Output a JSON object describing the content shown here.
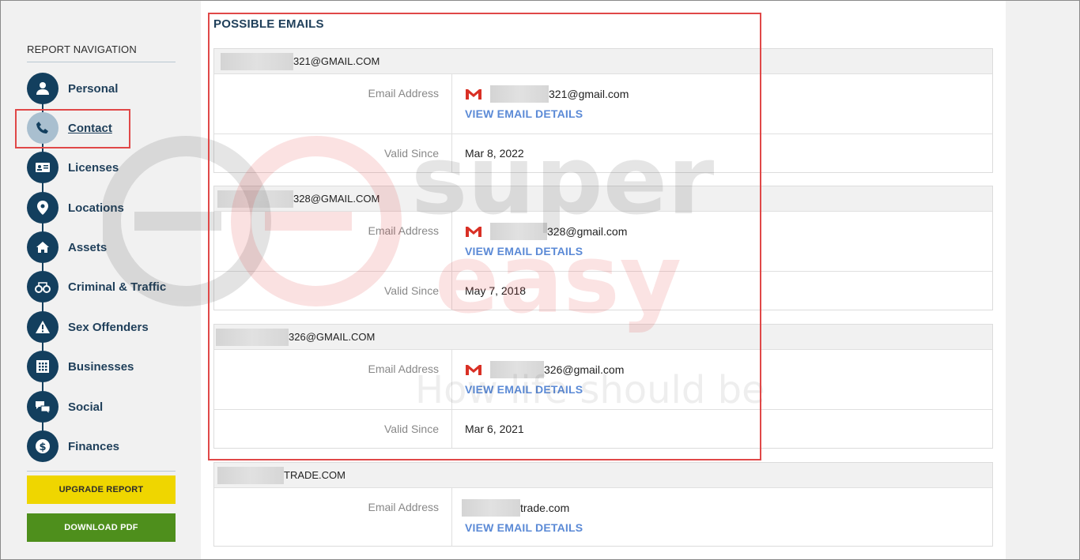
{
  "sidebar": {
    "title": "REPORT NAVIGATION",
    "items": [
      {
        "label": "Personal",
        "icon": "person-icon"
      },
      {
        "label": "Contact",
        "icon": "phone-icon"
      },
      {
        "label": "Licenses",
        "icon": "id-card-icon"
      },
      {
        "label": "Locations",
        "icon": "map-pin-icon"
      },
      {
        "label": "Assets",
        "icon": "home-icon"
      },
      {
        "label": "Criminal & Traffic",
        "icon": "handcuffs-icon"
      },
      {
        "label": "Sex Offenders",
        "icon": "warning-icon"
      },
      {
        "label": "Businesses",
        "icon": "building-icon"
      },
      {
        "label": "Social",
        "icon": "chat-icon"
      },
      {
        "label": "Finances",
        "icon": "dollar-icon"
      }
    ],
    "upgrade_label": "UPGRADE REPORT",
    "download_label": "DOWNLOAD PDF"
  },
  "main": {
    "section_title": "POSSIBLE EMAILS",
    "cards": [
      {
        "header": "321@GMAIL.COM",
        "email_label": "Email Address",
        "email_value": "321@gmail.com",
        "link": "VIEW EMAIL DETAILS",
        "since_label": "Valid Since",
        "since_value": "Mar 8, 2022"
      },
      {
        "header": "328@GMAIL.COM",
        "email_label": "Email Address",
        "email_value": "328@gmail.com",
        "link": "VIEW EMAIL DETAILS",
        "since_label": "Valid Since",
        "since_value": "May 7, 2018"
      },
      {
        "header": "326@GMAIL.COM",
        "email_label": "Email Address",
        "email_value": "326@gmail.com",
        "link": "VIEW EMAIL DETAILS",
        "since_label": "Valid Since",
        "since_value": "Mar 6, 2021"
      },
      {
        "header": "TRADE.COM",
        "email_label": "Email Address",
        "email_value": "trade.com",
        "link": "VIEW EMAIL DETAILS"
      }
    ]
  },
  "watermark": {
    "line1": "super",
    "line2": "easy",
    "tagline": "How life should be"
  },
  "colors": {
    "navy": "#133f5e",
    "link": "#5b8ad6",
    "highlight": "#e04848",
    "upgrade": "#efd600",
    "download": "#4e8f1c"
  }
}
